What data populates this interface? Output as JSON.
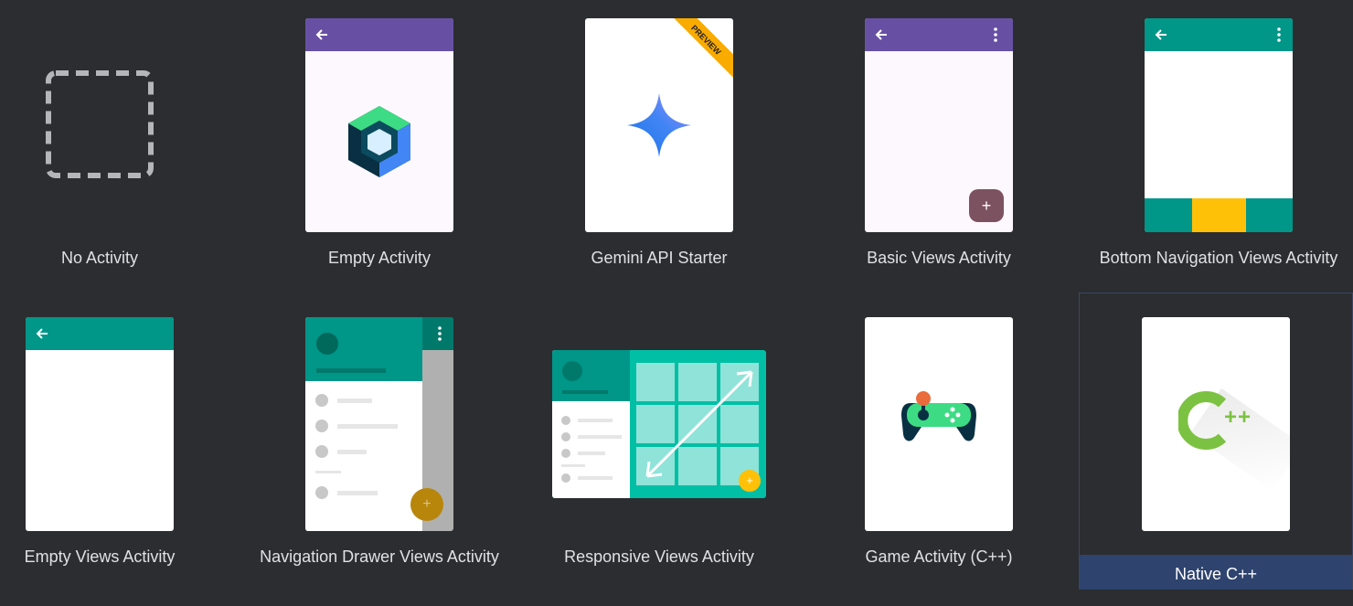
{
  "templates": [
    {
      "label": "No Activity"
    },
    {
      "label": "Empty Activity"
    },
    {
      "label": "Gemini API Starter",
      "badge": "PREVIEW"
    },
    {
      "label": "Basic Views Activity",
      "fab": "+"
    },
    {
      "label": "Bottom Navigation Views Activity"
    },
    {
      "label": "Empty Views Activity"
    },
    {
      "label": "Navigation Drawer Views Activity",
      "fab": "+"
    },
    {
      "label": "Responsive Views Activity",
      "fab": "+"
    },
    {
      "label": "Game Activity (C++)"
    },
    {
      "label": "Native C++",
      "logo_text": "++"
    }
  ],
  "selected": "Native C++",
  "colors": {
    "background": "#2b2d30",
    "purple_appbar": "#6750a4",
    "teal_appbar": "#009688",
    "fab_basic": "#7d5260",
    "bottom_nav_accent": "#ffc107",
    "selection": "#2e436e"
  }
}
